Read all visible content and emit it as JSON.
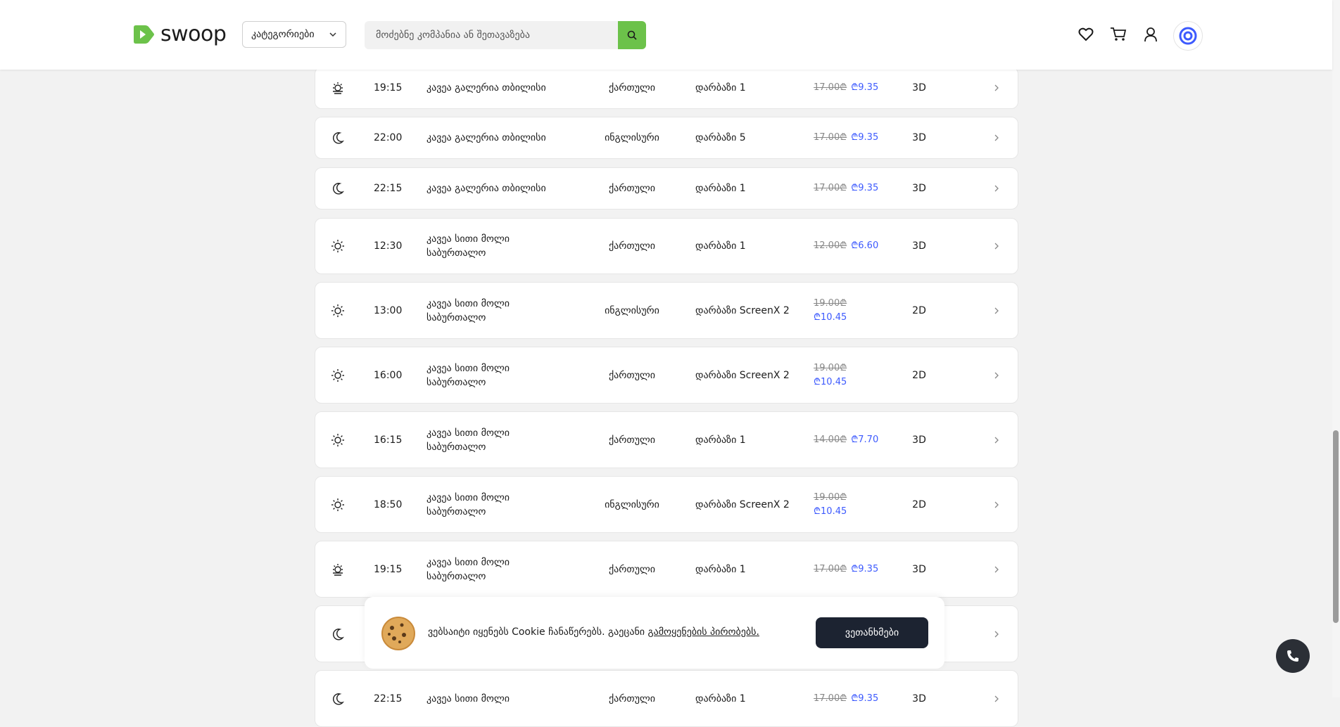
{
  "header": {
    "logo_text": "swoop",
    "categories_label": "კატეგორიები",
    "search_placeholder": "მოძებნე კომპანია ან შეთავაზება"
  },
  "rows": [
    {
      "tod": "sunset",
      "time": "19:15",
      "cinema": "კავეა გალერია თბილისი",
      "lang": "ქართული",
      "hall": "დარბაზი 1",
      "old_price": "17.00₾",
      "new_price": "₾9.35",
      "format": "3D"
    },
    {
      "tod": "moon",
      "time": "22:00",
      "cinema": "კავეა გალერია თბილისი",
      "lang": "ინგლისური",
      "hall": "დარბაზი 5",
      "old_price": "17.00₾",
      "new_price": "₾9.35",
      "format": "3D"
    },
    {
      "tod": "moon",
      "time": "22:15",
      "cinema": "კავეა გალერია თბილისი",
      "lang": "ქართული",
      "hall": "დარბაზი 1",
      "old_price": "17.00₾",
      "new_price": "₾9.35",
      "format": "3D"
    },
    {
      "tod": "sun",
      "time": "12:30",
      "cinema": "კავეა სითი მოლი საბურთალო",
      "lang": "ქართული",
      "hall": "დარბაზი 1",
      "old_price": "12.00₾",
      "new_price": "₾6.60",
      "format": "3D"
    },
    {
      "tod": "sun",
      "time": "13:00",
      "cinema": "კავეა სითი მოლი საბურთალო",
      "lang": "ინგლისური",
      "hall": "დარბაზი ScreenX 2",
      "old_price": "19.00₾",
      "new_price": "₾10.45",
      "format": "2D"
    },
    {
      "tod": "sun",
      "time": "16:00",
      "cinema": "კავეა სითი მოლი საბურთალო",
      "lang": "ქართული",
      "hall": "დარბაზი ScreenX 2",
      "old_price": "19.00₾",
      "new_price": "₾10.45",
      "format": "2D"
    },
    {
      "tod": "sun",
      "time": "16:15",
      "cinema": "კავეა სითი მოლი საბურთალო",
      "lang": "ქართული",
      "hall": "დარბაზი 1",
      "old_price": "14.00₾",
      "new_price": "₾7.70",
      "format": "3D"
    },
    {
      "tod": "sun",
      "time": "18:50",
      "cinema": "კავეა სითი მოლი საბურთალო",
      "lang": "ინგლისური",
      "hall": "დარბაზი ScreenX 2",
      "old_price": "19.00₾",
      "new_price": "₾10.45",
      "format": "2D"
    },
    {
      "tod": "sunset",
      "time": "19:15",
      "cinema": "კავეა სითი მოლი საბურთალო",
      "lang": "ქართული",
      "hall": "დარბაზი 1",
      "old_price": "17.00₾",
      "new_price": "₾9.35",
      "format": "3D"
    },
    {
      "tod": "moon",
      "time": "",
      "cinema": "",
      "lang": "",
      "hall": "",
      "old_price": "",
      "new_price": "",
      "format": ""
    },
    {
      "tod": "moon",
      "time": "22:15",
      "cinema": "კავეა სითი მოლი",
      "lang": "ქართული",
      "hall": "დარბაზი 1",
      "old_price": "17.00₾",
      "new_price": "₾9.35",
      "format": "3D"
    }
  ],
  "cookie": {
    "message": "ვებსაიტი იყენებს Cookie ჩანაწერებს. გაეცანი ",
    "link": "გამოყენების პირობებს.",
    "agree_label": "ვეთანხმები"
  },
  "colors": {
    "brand_green": "#6cc24a",
    "price_blue": "#3d5afe",
    "dark_button": "#1c2331"
  }
}
